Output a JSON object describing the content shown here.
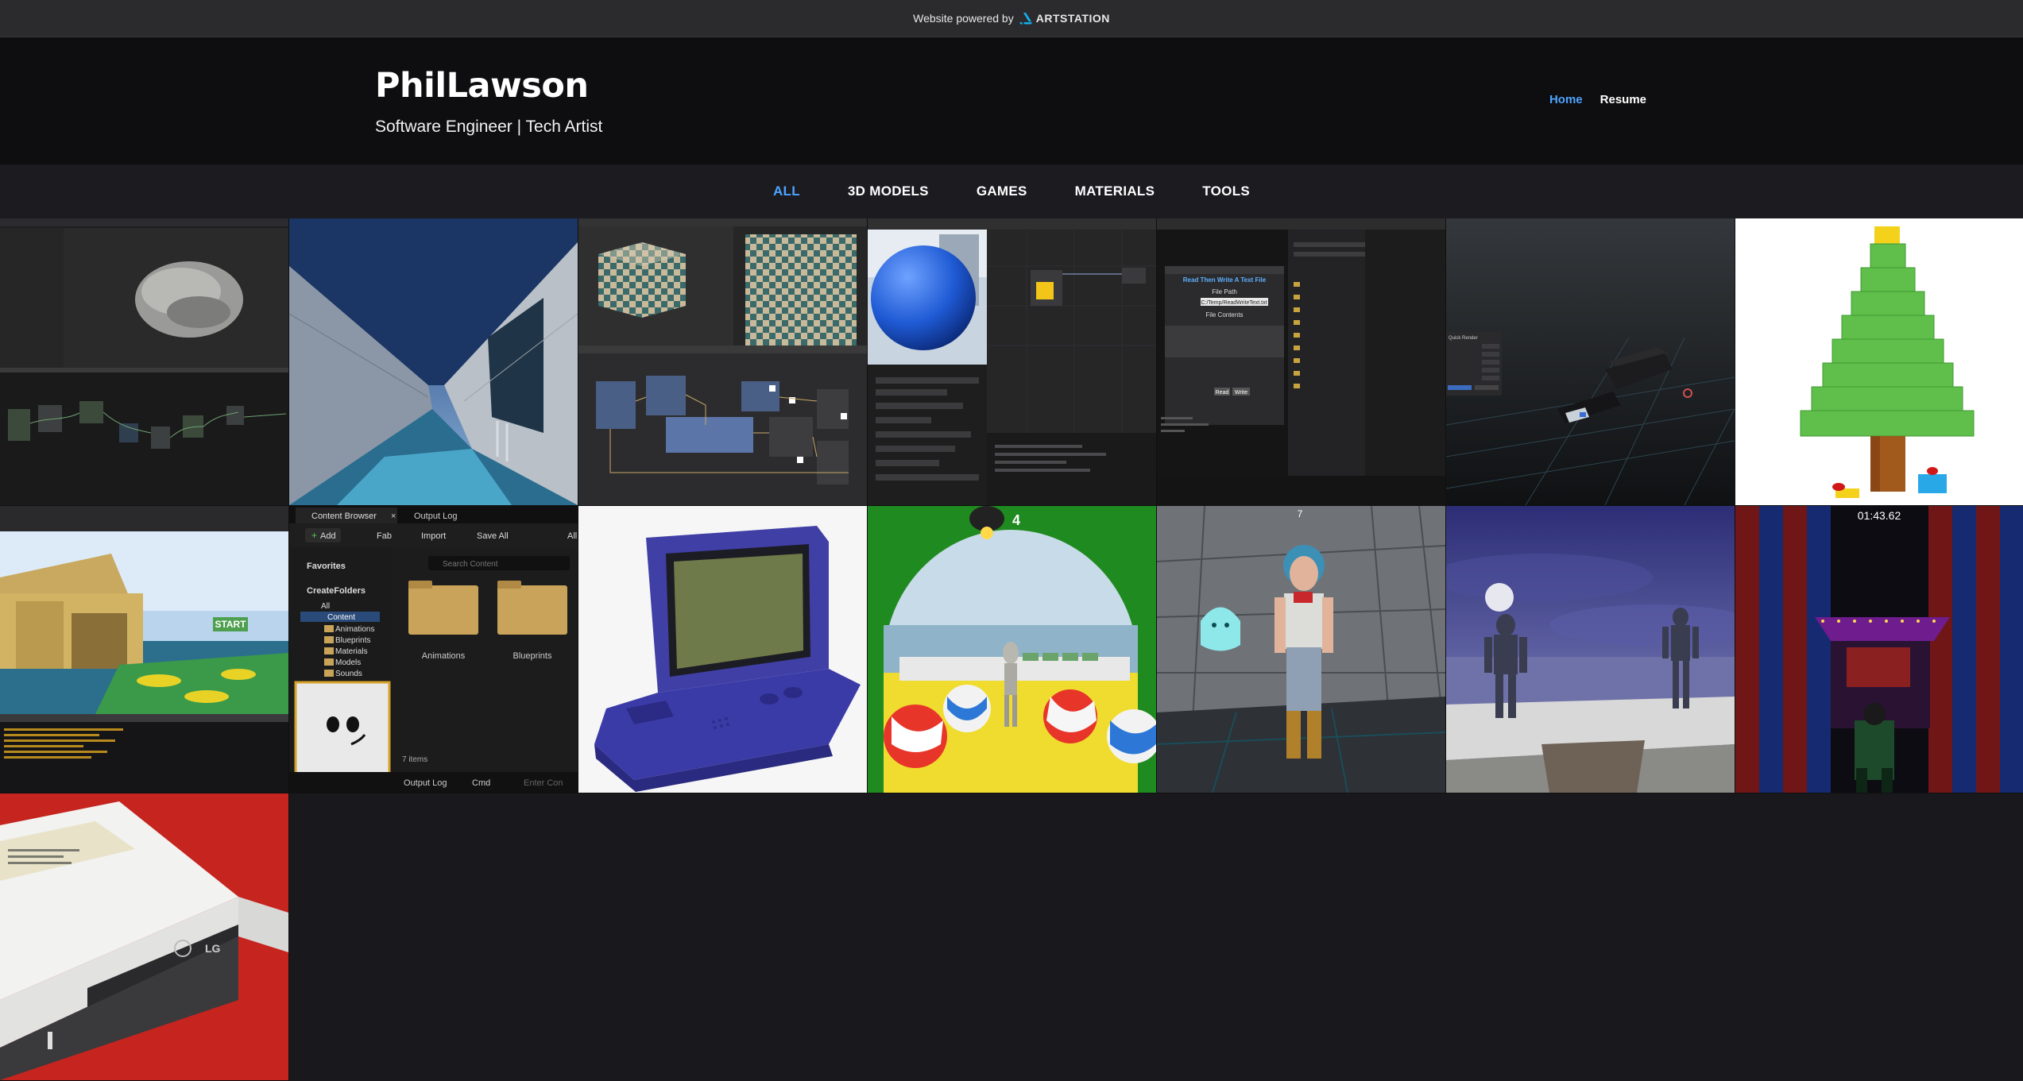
{
  "banner": {
    "text": "Website powered by",
    "brand": "ARTSTATION"
  },
  "header": {
    "title": "PhilLawson",
    "subtitle": "Software Engineer | Tech Artist",
    "nav": [
      {
        "label": "Home",
        "active": true
      },
      {
        "label": "Resume",
        "active": false
      }
    ]
  },
  "categories": [
    {
      "label": "ALL",
      "active": true
    },
    {
      "label": "3D MODELS",
      "active": false
    },
    {
      "label": "GAMES",
      "active": false
    },
    {
      "label": "MATERIALS",
      "active": false
    },
    {
      "label": "TOOLS",
      "active": false
    }
  ],
  "tiles": {
    "tile_6_popup": {
      "title": "Quick Render",
      "fields": [
        "Resolution X",
        "Resolution Y",
        "Resolution %",
        "Render Engine",
        "Use Denoise"
      ]
    },
    "tile_5": {
      "title": "Read Then Write A Text File",
      "file_path_label": "File Path",
      "file_path_value": "C:/Temp/ReadWriteText.txt",
      "contents_label": "File Contents",
      "read_label": "Read",
      "write_label": "Write"
    },
    "tile_9": {
      "tab_content_browser": "Content Browser",
      "tab_output_log": "Output Log",
      "add_label": "Add",
      "fab_label": "Fab",
      "import_label": "Import",
      "save_all_label": "Save All",
      "all_label": "All",
      "favorites_label": "Favorites",
      "createfolders_label": "CreateFolders",
      "search_placeholder": "Search Content",
      "tree": [
        "All",
        "Content",
        "Animations",
        "Blueprints",
        "Materials",
        "Models",
        "Sounds"
      ],
      "folders": [
        "Animations",
        "Blueprints"
      ],
      "item_count": "7 items",
      "footer_output_log": "Output Log",
      "footer_cmd": "Cmd",
      "footer_console_placeholder": "Enter Con"
    },
    "tile_11_counter": "4",
    "tile_12_counter": "7",
    "tile_14_timer": "01:43.62",
    "tile_15_brand": "LG"
  }
}
